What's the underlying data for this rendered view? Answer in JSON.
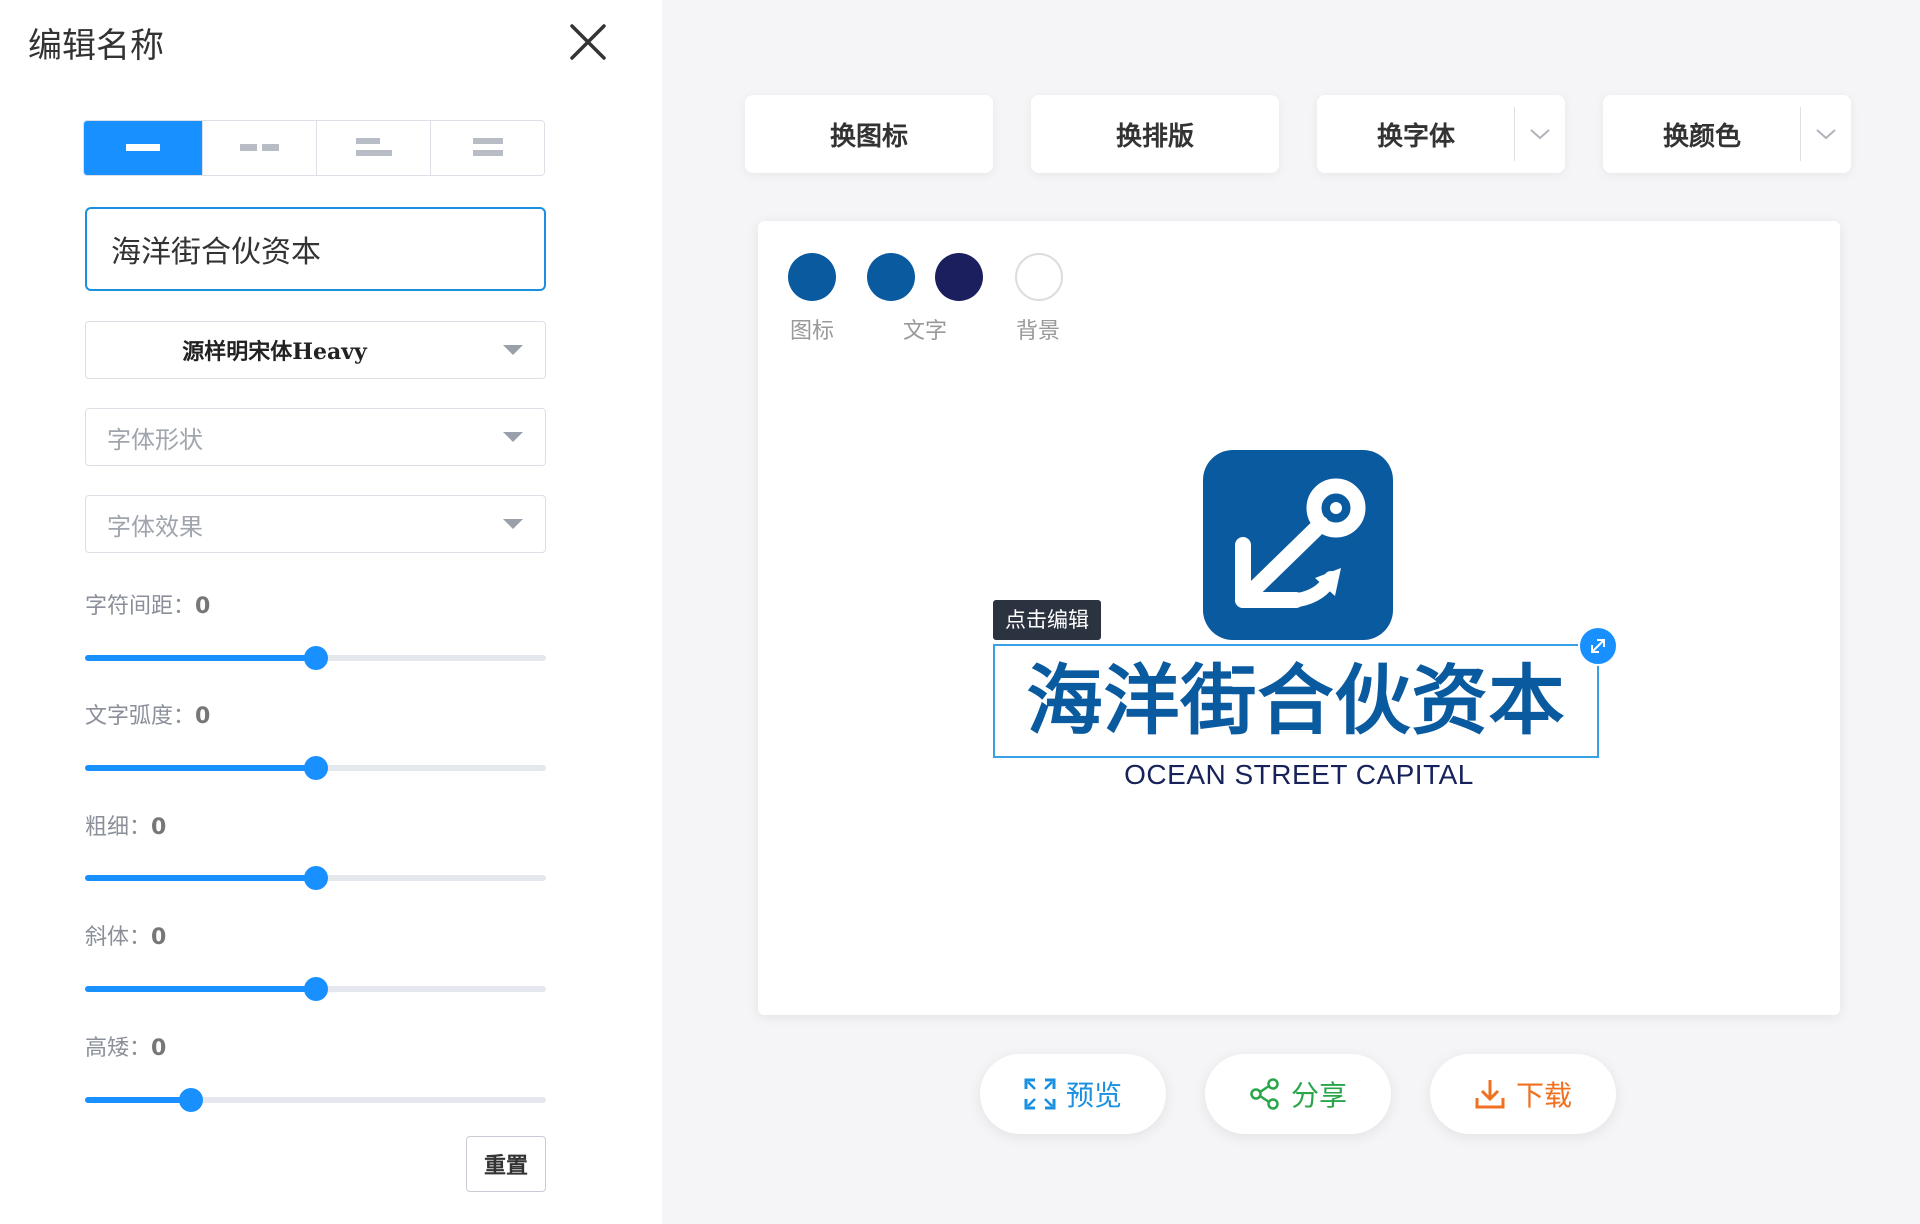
{
  "panel": {
    "title": "编辑名称",
    "name_value": "海洋街合伙资本",
    "font_select": "源样明宋体Heavy",
    "font_shape_placeholder": "字体形状",
    "font_effect_placeholder": "字体效果",
    "sliders": [
      {
        "label": "字符间距：",
        "value": "0",
        "level": 0.5
      },
      {
        "label": "文字弧度：",
        "value": "0",
        "level": 0.5
      },
      {
        "label": "粗细：",
        "value": "0",
        "level": 0.5
      },
      {
        "label": "斜体：",
        "value": "0",
        "level": 0.5
      },
      {
        "label": "高矮：",
        "value": "0",
        "level": 0.23
      }
    ],
    "reset_label": "重置"
  },
  "toolbar": {
    "change_icon": "换图标",
    "change_layout": "换排版",
    "change_font": "换字体",
    "change_color": "换颜色"
  },
  "canvas": {
    "swatches": [
      {
        "label": "图标",
        "color": "#0a5aa0"
      },
      {
        "label": "文字",
        "color": "#0a5aa0"
      },
      {
        "label": "",
        "color": "#1b1f5e"
      },
      {
        "label": "背景",
        "color": "#ffffff"
      }
    ],
    "edit_tip": "点击编辑",
    "logo_text": "海洋街合伙资本",
    "logo_subtext": "OCEAN STREET CAPITAL"
  },
  "actions": {
    "preview": "预览",
    "share": "分享",
    "download": "下载"
  },
  "colors": {
    "accent": "#1890ff",
    "brand": "#0a5aa0",
    "preview": "#1a90e0",
    "share": "#2aa64a",
    "download": "#f07020"
  }
}
